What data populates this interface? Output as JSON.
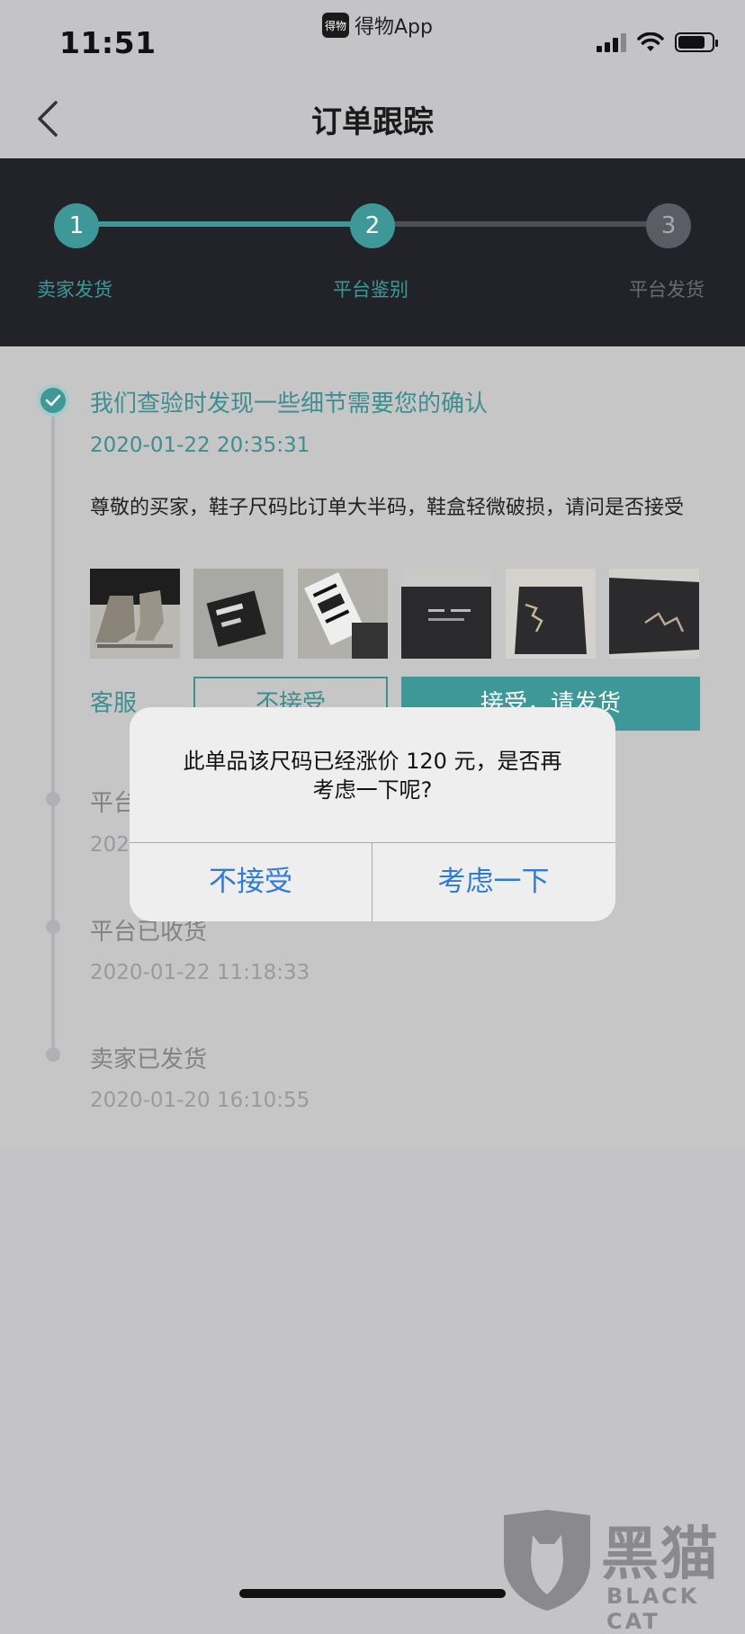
{
  "status_bar": {
    "time": "11:51",
    "app_badge": "得物",
    "app_name": "得物App"
  },
  "header": {
    "title": "订单跟踪"
  },
  "steps": [
    {
      "number": "1",
      "label": "卖家发货"
    },
    {
      "number": "2",
      "label": "平台鉴别"
    },
    {
      "number": "3",
      "label": "平台发货"
    }
  ],
  "events": [
    {
      "title": "我们查验时发现一些细节需要您的确认",
      "time": "2020-01-22 20:35:31",
      "description": "尊敬的买家，鞋子尺码比订单大半码，鞋盒轻微破损，请问是否接受"
    },
    {
      "title": "平台",
      "time": "202"
    },
    {
      "title": "平台已收货",
      "time": "2020-01-22 11:18:33"
    },
    {
      "title": "卖家已发货",
      "time": "2020-01-20 16:10:55"
    }
  ],
  "actions": {
    "service": "客服",
    "reject": "不接受",
    "accept": "接受，请发货"
  },
  "dialog": {
    "message_line1": "此单品该尺码已经涨价 120 元，是否再",
    "message_line2": "考虑一下呢?",
    "reject": "不接受",
    "reconsider": "考虑一下"
  },
  "watermark": {
    "text": "黑猫",
    "subtext": "BLACK CAT"
  },
  "colors": {
    "accent": "#3e9898",
    "dialog_button": "#2f7bd8",
    "panel": "#222329"
  }
}
